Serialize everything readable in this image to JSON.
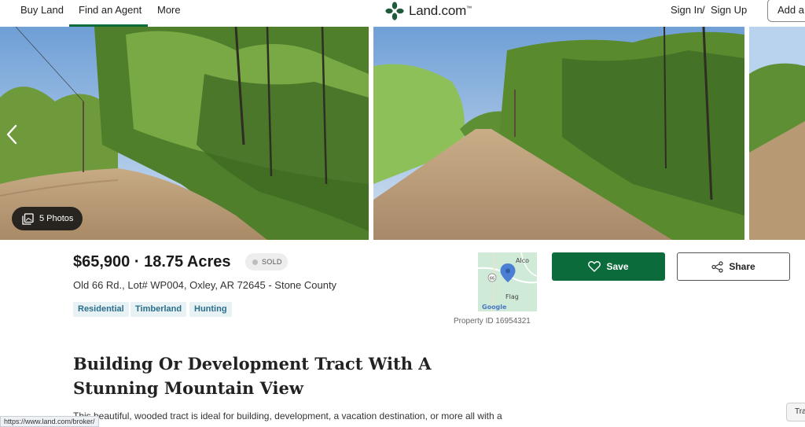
{
  "nav": {
    "left_items": [
      "Buy Land",
      "Find an Agent",
      "More"
    ],
    "active_item": "Find an Agent",
    "logo_text": "Land.com",
    "logo_mark": "™",
    "sign_in": "Sign In",
    "separator": "/",
    "sign_up": "Sign Up",
    "add_button": "Add a"
  },
  "gallery": {
    "photos_label": "5 Photos",
    "icons": {
      "prev": "chevron-left-icon",
      "photos": "photo-stack-icon"
    }
  },
  "listing": {
    "price_acres": "$65,900 · 18.75 Acres",
    "status": "SOLD",
    "address": "Old 66 Rd., Lot# WP004, Oxley, AR 72645 - Stone County",
    "tags": [
      "Residential",
      "Timberland",
      "Hunting"
    ],
    "property_id": "Property ID 16954321"
  },
  "map": {
    "labels": {
      "town_top": "Alco",
      "road": "66",
      "town_bottom": "Flag",
      "provider": "Google"
    }
  },
  "actions": {
    "save_label": "Save",
    "share_label": "Share"
  },
  "description": {
    "headline": "Building Or Development Tract With A Stunning Mountain View",
    "body": "This beautiful, wooded tract is ideal for building, development, a vacation destination, or more all with a"
  },
  "browser": {
    "status_url": "https://www.land.com/broker/",
    "chat_tab": "Tra"
  },
  "colors": {
    "brand_green": "#0c6b3a",
    "tag_text": "#2a6f8a",
    "tag_bg": "#e8f1f4"
  }
}
